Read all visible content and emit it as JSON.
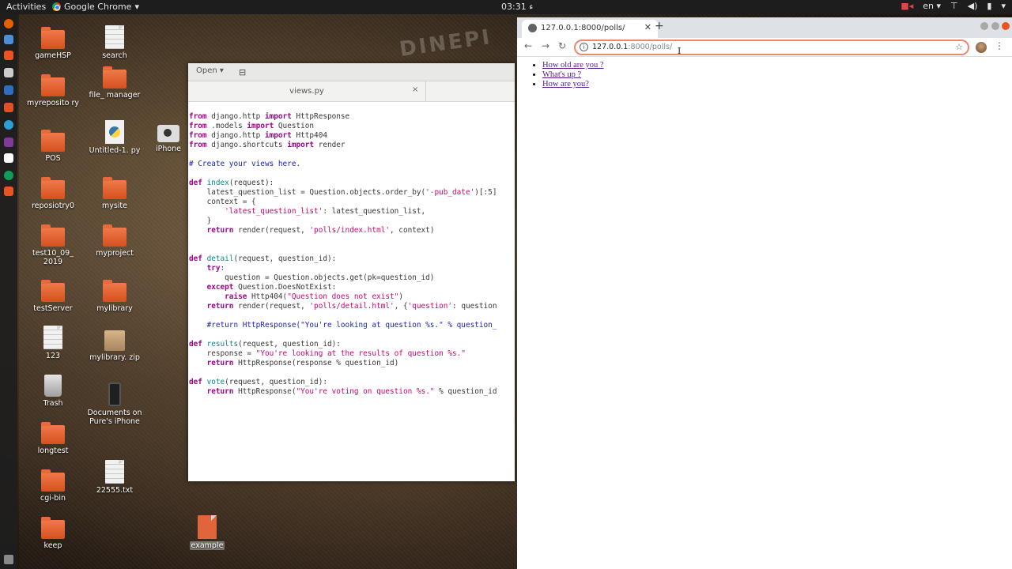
{
  "topbar": {
    "activities": "Activities",
    "app_name": "Google Chrome",
    "clock": "ء 03:31",
    "language": "en"
  },
  "desktop": {
    "icons": [
      {
        "label": "gameHSP",
        "type": "folder"
      },
      {
        "label": "search",
        "type": "file"
      },
      {
        "label": "myreposito ry",
        "type": "folder"
      },
      {
        "label": "file_ manager",
        "type": "folder"
      },
      {
        "label": "POS",
        "type": "folder"
      },
      {
        "label": "Untitled-1. py",
        "type": "python"
      },
      {
        "label": "iPhone",
        "type": "camera"
      },
      {
        "label": "reposiotry0",
        "type": "folder"
      },
      {
        "label": "mysite",
        "type": "folder"
      },
      {
        "label": "test10_09_ 2019",
        "type": "folder"
      },
      {
        "label": "myproject",
        "type": "folder"
      },
      {
        "label": "testServer",
        "type": "folder"
      },
      {
        "label": "mylibrary",
        "type": "folder"
      },
      {
        "label": "123",
        "type": "file"
      },
      {
        "label": "mylibrary. zip",
        "type": "zip"
      },
      {
        "label": "Trash",
        "type": "trash"
      },
      {
        "label": "Documents on Pure's iPhone",
        "type": "phone"
      },
      {
        "label": "longtest",
        "type": "folder"
      },
      {
        "label": "cgi-bin",
        "type": "folder"
      },
      {
        "label": "22555.txt",
        "type": "file"
      },
      {
        "label": "keep",
        "type": "folder"
      },
      {
        "label": "example",
        "type": "file-orange"
      }
    ]
  },
  "editor": {
    "open_label": "Open",
    "tab_title": "views.py",
    "code_lines": [
      "from django.http import HttpResponse",
      "from .models import Question",
      "from django.http import Http404",
      "from django.shortcuts import render",
      "",
      "# Create your views here.",
      "",
      "def index(request):",
      "    latest_question_list = Question.objects.order_by('-pub_date')[:5]",
      "    context = {",
      "        'latest_question_list': latest_question_list,",
      "    }",
      "    return render(request, 'polls/index.html', context)",
      "",
      "",
      "def detail(request, question_id):",
      "    try:",
      "        question = Question.objects.get(pk=question_id)",
      "    except Question.DoesNotExist:",
      "        raise Http404(\"Question does not exist\")",
      "    return render(request, 'polls/detail.html', {'question': question",
      "",
      "    #return HttpResponse(\"You're looking at question %s.\" % question_",
      "",
      "def results(request, question_id):",
      "    response = \"You're looking at the results of question %s.\"",
      "    return HttpResponse(response % question_id)",
      "",
      "def vote(request, question_id):",
      "    return HttpResponse(\"You're voting on question %s.\" % question_id"
    ]
  },
  "browser": {
    "tab_title": "127.0.0.1:8000/polls/",
    "url_host": "127.0.0.1",
    "url_path": ":8000/polls/",
    "links": [
      "How old are you ?",
      "What's up ?",
      "How are you?"
    ]
  }
}
